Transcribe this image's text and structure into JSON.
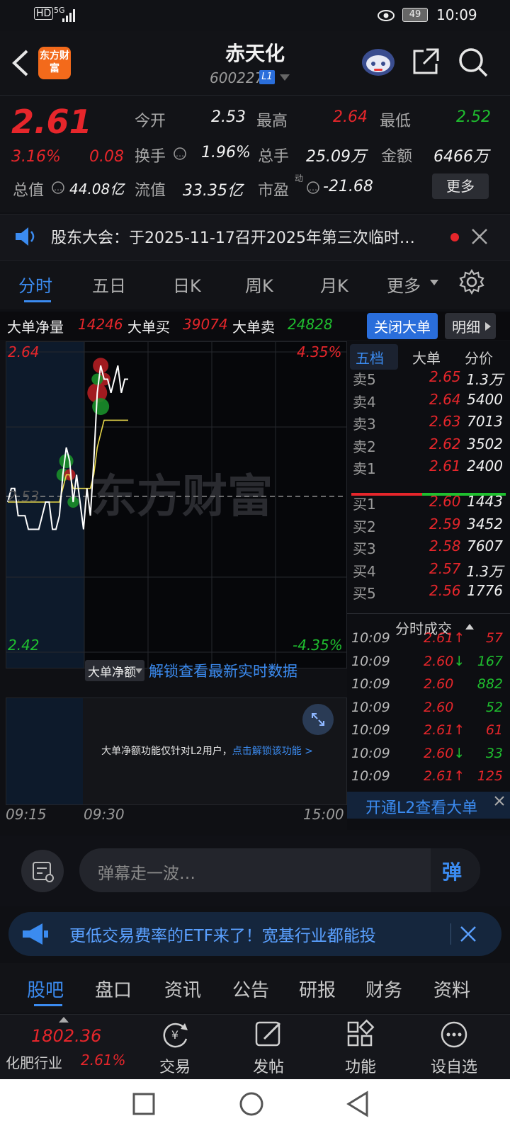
{
  "status": {
    "hd": "HD",
    "net": "5G",
    "battery": "49",
    "time": "10:09"
  },
  "header": {
    "logo": "东方财富",
    "title": "赤天化",
    "code": "600227",
    "badge": "L1"
  },
  "quote": {
    "price": "2.61",
    "change_pct": "3.16%",
    "change": "0.08",
    "open_label": "今开",
    "open": "2.53",
    "high_label": "最高",
    "high": "2.64",
    "low_label": "最低",
    "low": "2.52",
    "turnover_label": "换手",
    "turnover": "1.96%",
    "volume_label": "总手",
    "volume": "25.09万",
    "amount_label": "金额",
    "amount": "6466万",
    "mcap_label": "总值",
    "mcap": "44.08亿",
    "float_label": "流值",
    "float": "33.35亿",
    "pe_label": "市盈",
    "pe_sup": "动",
    "pe": "-21.68",
    "more": "更多"
  },
  "notice": {
    "text": "股东大会：于2025-11-17召开2025年第三次临时…"
  },
  "tabs": [
    "分时",
    "五日",
    "日K",
    "周K",
    "月K",
    "更多"
  ],
  "bigorder": {
    "net_label": "大单净量",
    "net": "14246",
    "buy_label": "大单买",
    "buy": "39074",
    "sell_label": "大单卖",
    "sell": "24828",
    "close_btn": "关闭大单",
    "detail_btn": "明细"
  },
  "chart_data": {
    "type": "line",
    "y_top_label": "2.64",
    "y_mid_label": "2.53",
    "y_bottom_label": "2.42",
    "pct_top": "4.35%",
    "pct_bottom": "-4.35%",
    "ylim": [
      2.42,
      2.64
    ],
    "ref": 2.53,
    "x_labels": [
      "09:15",
      "09:30",
      "15:00"
    ],
    "watermark": "东方财富",
    "price_series": [
      2.53,
      2.54,
      2.54,
      2.52,
      2.52,
      2.52,
      2.51,
      2.51,
      2.51,
      2.51,
      2.52,
      2.53,
      2.53,
      2.51,
      2.51,
      2.52,
      2.55,
      2.57,
      2.56,
      2.53,
      2.55,
      2.53,
      2.51,
      2.54,
      2.52,
      2.56,
      2.61,
      2.63,
      2.62,
      2.62,
      2.61,
      2.62,
      2.63,
      2.61,
      2.62,
      2.62
    ],
    "avg_series": [
      2.53,
      2.53,
      2.53,
      2.53,
      2.53,
      2.53,
      2.53,
      2.53,
      2.53,
      2.53,
      2.53,
      2.53,
      2.53,
      2.53,
      2.53,
      2.53,
      2.54,
      2.55,
      2.55,
      2.54,
      2.54,
      2.54,
      2.54,
      2.54,
      2.54,
      2.55,
      2.57,
      2.58,
      2.59,
      2.59,
      2.59,
      2.59,
      2.59,
      2.59,
      2.59,
      2.59
    ]
  },
  "lower": {
    "selector": "大单净额",
    "unlock": "解锁查看最新实时数据",
    "note": "大单净额功能仅针对L2用户，",
    "note_link": "点击解锁该功能 >"
  },
  "book": {
    "tabs": [
      "五档",
      "大单",
      "分价"
    ],
    "asks": [
      {
        "label": "卖5",
        "price": "2.65",
        "vol": "1.3万"
      },
      {
        "label": "卖4",
        "price": "2.64",
        "vol": "5400"
      },
      {
        "label": "卖3",
        "price": "2.63",
        "vol": "7013"
      },
      {
        "label": "卖2",
        "price": "2.62",
        "vol": "3502"
      },
      {
        "label": "卖1",
        "price": "2.61",
        "vol": "2400"
      }
    ],
    "bids": [
      {
        "label": "买1",
        "price": "2.60",
        "vol": "1443"
      },
      {
        "label": "买2",
        "price": "2.59",
        "vol": "3452"
      },
      {
        "label": "买3",
        "price": "2.58",
        "vol": "7607"
      },
      {
        "label": "买4",
        "price": "2.57",
        "vol": "1.3万"
      },
      {
        "label": "买5",
        "price": "2.56",
        "vol": "1776"
      }
    ],
    "trades_title": "分时成交",
    "trades": [
      {
        "time": "10:09",
        "price": "2.61",
        "dir": "↑",
        "vol": "57",
        "c": "red",
        "vc": "red"
      },
      {
        "time": "10:09",
        "price": "2.60",
        "dir": "↓",
        "vol": "167",
        "c": "red",
        "vc": "green"
      },
      {
        "time": "10:09",
        "price": "2.60",
        "dir": "",
        "vol": "882",
        "c": "red",
        "vc": "green"
      },
      {
        "time": "10:09",
        "price": "2.60",
        "dir": "",
        "vol": "52",
        "c": "red",
        "vc": "green"
      },
      {
        "time": "10:09",
        "price": "2.61",
        "dir": "↑",
        "vol": "61",
        "c": "red",
        "vc": "red"
      },
      {
        "time": "10:09",
        "price": "2.60",
        "dir": "↓",
        "vol": "33",
        "c": "red",
        "vc": "green"
      },
      {
        "time": "10:09",
        "price": "2.61",
        "dir": "↑",
        "vol": "125",
        "c": "red",
        "vc": "red"
      }
    ],
    "l2_promo": "开通L2查看大单"
  },
  "danmaku": {
    "placeholder": "弹幕走一波…",
    "btn": "弹"
  },
  "promo": {
    "text": "更低交易费率的ETF来了！宽基行业都能投"
  },
  "sectabs": [
    "股吧",
    "盘口",
    "资讯",
    "公告",
    "研报",
    "财务",
    "资料"
  ],
  "bottomnav": {
    "index_value": "1802.36",
    "index_name": "化肥行业",
    "index_pct": "2.61%",
    "items": [
      "交易",
      "发帖",
      "功能",
      "设自选"
    ]
  }
}
